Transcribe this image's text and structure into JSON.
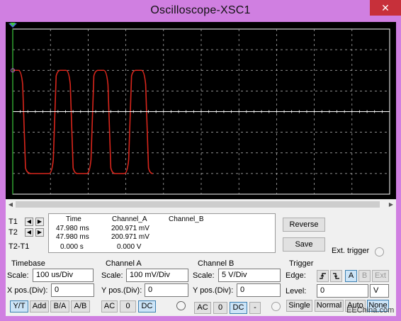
{
  "window": {
    "title": "Oscilloscope-XSC1",
    "close_glyph": "✕",
    "frame_color": "#d07fe1"
  },
  "screen": {
    "background": "#000000",
    "grid_color": "#ffffff",
    "trace_a_color": "#d9261c",
    "trace_b_color": "#ffffff",
    "cursor_color": "#3cc83c",
    "cursor_t2_color": "#4f6fd8",
    "trace_a": {
      "high_level": "200 mV",
      "low_level": "-300 mV",
      "period_div": 1
    }
  },
  "scroll": {
    "left_glyph": "◀",
    "right_glyph": "▶"
  },
  "measurements": {
    "t1_label": "T1",
    "t2_label": "T2",
    "t2t1_label": "T2-T1",
    "left_arrow": "◀",
    "right_arrow": "▶",
    "headers": [
      "Time",
      "Channel_A",
      "Channel_B"
    ],
    "rows": [
      [
        "47.980 ms",
        "200.971 mV",
        ""
      ],
      [
        "47.980 ms",
        "200.971 mV",
        ""
      ],
      [
        "0.000 s",
        "0.000 V",
        ""
      ]
    ]
  },
  "actions": {
    "reverse": "Reverse",
    "save": "Save",
    "ext_trigger": "Ext. trigger"
  },
  "timebase": {
    "title": "Timebase",
    "scale_label": "Scale:",
    "scale_value": "100 us/Div",
    "xpos_label": "X pos.(Div):",
    "xpos_value": "0",
    "buttons": [
      "Y/T",
      "Add",
      "B/A",
      "A/B"
    ]
  },
  "channel_a": {
    "title": "Channel A",
    "scale_label": "Scale:",
    "scale_value": "100 mV/Div",
    "ypos_label": "Y pos.(Div):",
    "ypos_value": "0",
    "buttons": [
      "AC",
      "0",
      "DC"
    ]
  },
  "channel_b": {
    "title": "Channel B",
    "scale_label": "Scale:",
    "scale_value": "5  V/Div",
    "ypos_label": "Y pos.(Div):",
    "ypos_value": "0",
    "buttons": [
      "AC",
      "0",
      "DC",
      "-"
    ]
  },
  "trigger": {
    "title": "Trigger",
    "edge_label": "Edge:",
    "edge_buttons": [
      "A",
      "B",
      "Ext"
    ],
    "level_label": "Level:",
    "level_value": "0",
    "level_unit": "V",
    "mode_buttons": [
      "Single",
      "Normal",
      "Auto",
      "None"
    ]
  },
  "watermark": "EEChina.com"
}
